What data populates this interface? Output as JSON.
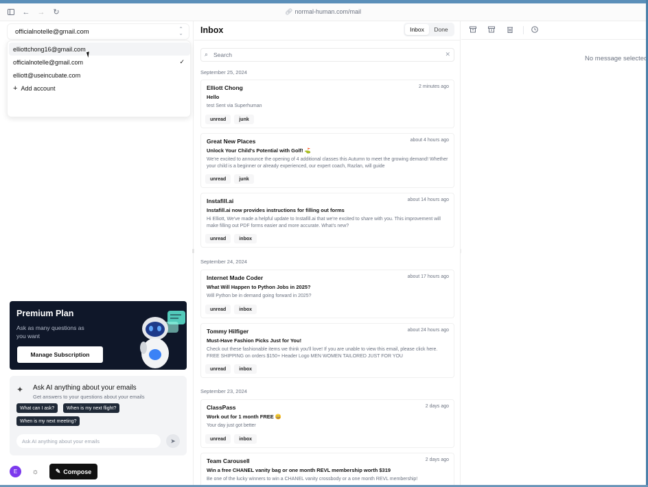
{
  "browser": {
    "url": "normal-human.com/mail"
  },
  "sidebar": {
    "selected_account": "officialnotelle@gmail.com",
    "accounts": [
      {
        "email": "elliottchong16@gmail.com",
        "selected": false
      },
      {
        "email": "officialnotelle@gmail.com",
        "selected": true
      },
      {
        "email": "elliott@useincubate.com",
        "selected": false
      }
    ],
    "add_account_label": "Add account",
    "premium": {
      "title": "Premium Plan",
      "subtitle": "Ask as many questions as you want",
      "button_label": "Manage Subscription"
    },
    "ask_ai": {
      "title": "Ask AI anything about your emails",
      "subtitle": "Get answers to your questions about your emails",
      "chips": [
        "What can I ask?",
        "When is my next flight?",
        "When is my next meeting?"
      ],
      "input_placeholder": "Ask AI anything about your emails"
    },
    "avatar_initial": "E",
    "compose_label": "Compose"
  },
  "inbox": {
    "title": "Inbox",
    "tabs": [
      {
        "label": "Inbox",
        "active": true
      },
      {
        "label": "Done",
        "active": false
      }
    ],
    "search_placeholder": "Search",
    "groups": [
      {
        "date": "September 25, 2024"
      },
      {
        "date": "September 24, 2024"
      },
      {
        "date": "September 23, 2024"
      }
    ],
    "emails": [
      {
        "from": "Elliott Chong",
        "time": "2 minutes ago",
        "subject": "Hello",
        "snippet": "test Sent via Superhuman",
        "tags": [
          "unread",
          "junk"
        ]
      },
      {
        "from": "Great New Places",
        "time": "about 4 hours ago",
        "subject": "Unlock Your Child's Potential with Golf! ⛳",
        "snippet": "We're excited to announce the opening of 4 additional classes this Autumn to meet the growing demand! Whether your child is a beginner or already experienced, our expert coach, Razlan, will guide",
        "tags": [
          "unread",
          "junk"
        ]
      },
      {
        "from": "Instafill.ai",
        "time": "about 14 hours ago",
        "subject": "Instafill.ai now provides instructions for filling out forms",
        "snippet": "Hi Elliott, We've made a helpful update to Instafill.ai that we're excited to share with you. This improvement will make filling out PDF forms easier and more accurate. What's new?",
        "tags": [
          "unread",
          "inbox"
        ]
      },
      {
        "from": "Internet Made Coder",
        "time": "about 17 hours ago",
        "subject": "What Will Happen to Python Jobs in 2025?",
        "snippet": "Will Python be in demand going forward in 2025?",
        "tags": [
          "unread",
          "inbox"
        ]
      },
      {
        "from": "Tommy Hilfiger",
        "time": "about 24 hours ago",
        "subject": "Must-Have Fashion Picks Just for You!",
        "snippet": "Check out these fashionable items we think you'll love! If you are unable to view this email, please click here. FREE SHIPPING on orders $150+ Header Logo MEN WOMEN TAILORED JUST FOR YOU",
        "tags": [
          "unread",
          "inbox"
        ]
      },
      {
        "from": "ClassPass",
        "time": "2 days ago",
        "subject": "Work out for 1 month FREE 😀",
        "snippet": "Your day just got better",
        "tags": [
          "unread",
          "inbox"
        ]
      },
      {
        "from": "Team Carousell",
        "time": "2 days ago",
        "subject": "Win a free CHANEL vanity bag or one month REVL membership worth $319",
        "snippet": "Be one of the lucky winners to win a CHANEL vanity crossbody or a one month REVL membership!",
        "tags": []
      }
    ]
  },
  "detail": {
    "empty_text": "No message selected"
  },
  "colors": {
    "accent": "#111111",
    "premium_bg": "#0f1729",
    "avatar": "#7c3aed",
    "robot_accent": "#5eead4"
  }
}
